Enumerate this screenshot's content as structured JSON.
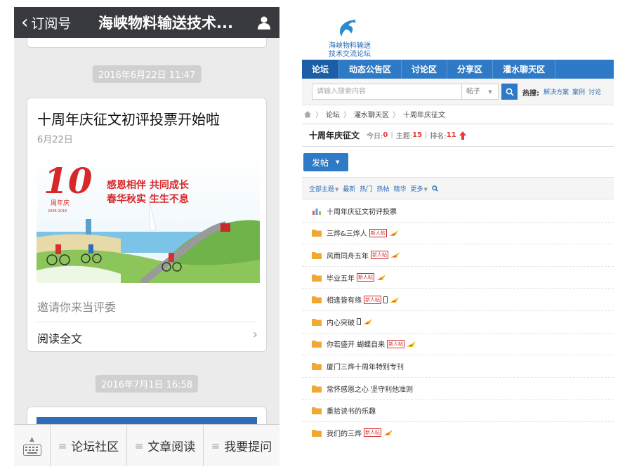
{
  "wechat": {
    "header": {
      "back_label": "订阅号",
      "title": "海峡物料输送技术..."
    },
    "messages": [
      {
        "time": "2016年6月22日 11:47",
        "title": "十周年庆征文初评投票开始啦",
        "date": "6月22日",
        "description": "邀请你来当评委",
        "read_more": "阅读全文",
        "banner": {
          "slogan_line1": "感恩相伴  共同成长",
          "slogan_line2": "春华秋实  生生不息",
          "anniv_label": "周年庆",
          "anniv_years": "2006-2016"
        }
      },
      {
        "time": "2016年7月1日 16:58"
      }
    ],
    "menu": [
      "论坛社区",
      "文章阅读",
      "我要提问"
    ]
  },
  "forum": {
    "logo_text": [
      "海峡物料输送",
      "技术交流论坛"
    ],
    "nav": [
      "论坛",
      "动态公告区",
      "讨论区",
      "分享区",
      "灌水聊天区"
    ],
    "search": {
      "placeholder": "请输入搜索内容",
      "type": "帖子",
      "hot_label": "热搜:",
      "hot_links": [
        "解决方案",
        "案例",
        "讨论"
      ]
    },
    "breadcrumb": [
      "论坛",
      "灌水聊天区",
      "十周年庆征文"
    ],
    "board": {
      "name": "十周年庆征文",
      "today_label": "今日:",
      "today": "0",
      "topics_label": "主题:",
      "topics": "15",
      "rank_label": "排名:",
      "rank": "11"
    },
    "post_button": "发帖",
    "filters": [
      "全部主题",
      "最新",
      "热门",
      "热帖",
      "精华",
      "更多"
    ],
    "badge_new": "新人帖",
    "threads": [
      {
        "title": "十周年庆征文初评投票",
        "icon": "poll",
        "new": false,
        "hot": false,
        "phone": false
      },
      {
        "title": "三烨&三烨人",
        "icon": "folder",
        "new": true,
        "hot": true,
        "phone": false
      },
      {
        "title": "风雨同舟五年",
        "icon": "folder",
        "new": true,
        "hot": true,
        "phone": false
      },
      {
        "title": "毕业五年",
        "icon": "folder",
        "new": true,
        "hot": true,
        "phone": false
      },
      {
        "title": "相逢皆有缘",
        "icon": "folder",
        "new": true,
        "hot": true,
        "phone": true
      },
      {
        "title": "内心突破",
        "icon": "folder",
        "new": false,
        "hot": true,
        "phone": true
      },
      {
        "title": "你若盛开 蝴蝶自来",
        "icon": "folder",
        "new": true,
        "hot": true,
        "phone": false
      },
      {
        "title": "厦门三烨十周年特别专刊",
        "icon": "folder",
        "new": false,
        "hot": false,
        "phone": false
      },
      {
        "title": "常怀感恩之心 坚守利他准则",
        "icon": "folder",
        "new": false,
        "hot": false,
        "phone": false
      },
      {
        "title": "重拾读书的乐趣",
        "icon": "folder",
        "new": false,
        "hot": false,
        "phone": false
      },
      {
        "title": "我们的三烨",
        "icon": "folder",
        "new": true,
        "hot": true,
        "phone": false
      }
    ]
  },
  "colors": {
    "wechat_header": "#393a3f",
    "forum_blue": "#2f7ac6",
    "folder": "#f0a830",
    "hot_red": "#e23c3c"
  }
}
